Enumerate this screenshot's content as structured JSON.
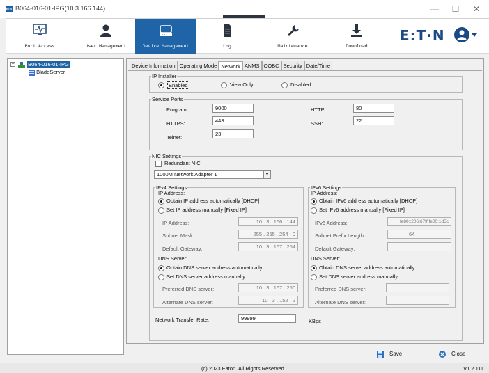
{
  "window": {
    "title": "B064-016-01-IPG(10.3.166.144)",
    "app_icon_text": "ETN",
    "minimize": "—",
    "maximize": "☐",
    "close": "✕"
  },
  "toolbar": {
    "items": [
      {
        "label": "Port Access",
        "icon": "monitor-pulse-icon"
      },
      {
        "label": "User Management",
        "icon": "user-icon"
      },
      {
        "label": "Device Management",
        "icon": "server-icon"
      },
      {
        "label": "Log",
        "icon": "document-icon"
      },
      {
        "label": "Maintenance",
        "icon": "wrench-icon"
      },
      {
        "label": "Download",
        "icon": "download-icon"
      }
    ],
    "active_index": 2,
    "brand": "E:T·N",
    "brand_color": "#1a4a86",
    "accent_color": "#1e64a6"
  },
  "tree": {
    "root": {
      "expander": "−",
      "label": "B064-016-01-IPG"
    },
    "child": {
      "label": "BladeServer"
    }
  },
  "tabs": [
    "Device Information",
    "Operating Mode",
    "Network",
    "ANMS",
    "OOBC",
    "Security",
    "Date/Time"
  ],
  "active_tab": "Network",
  "ip_installer": {
    "legend": "IP Installer",
    "options": [
      "Enabled",
      "View Only",
      "Disabled"
    ],
    "selected": "Enabled"
  },
  "service_ports": {
    "legend": "Service Ports",
    "program": {
      "label": "Program:",
      "value": "9000"
    },
    "https": {
      "label": "HTTPS:",
      "value": "443"
    },
    "telnet": {
      "label": "Telnet:",
      "value": "23"
    },
    "http": {
      "label": "HTTP:",
      "value": "80"
    },
    "ssh": {
      "label": "SSH:",
      "value": "22"
    }
  },
  "nic": {
    "legend": "NIC Settings",
    "redundant_label": "Redundant NIC",
    "redundant_checked": false,
    "adapter": "1000M Network Adapter 1",
    "adapter_arrow": "▾",
    "ipv4": {
      "legend": "IPv4 Settings",
      "ip_address_heading": "IP Address:",
      "auto_label": "Obtain IP address automatically [DHCP]",
      "manual_label": "Set IP address manually [Fixed IP]",
      "selected": "auto",
      "ip_label": "IP Address:",
      "ip_value": "10 . 3 . 166 . 144",
      "mask_label": "Subnet Mask:",
      "mask_value": "255 . 255 . 254 . 0",
      "gateway_label": "Default Gateway:",
      "gateway_value": "10 . 3 . 167 . 254",
      "dns_heading": "DNS Server:",
      "dns_auto_label": "Obtain DNS server address automatically",
      "dns_manual_label": "Set DNS server address manually",
      "dns_selected": "auto",
      "preferred_label": "Preferred DNS server:",
      "preferred_value": "10 . 3 . 167 . 250",
      "alternate_label": "Alternate DNS server:",
      "alternate_value": "10 . 3 . 152 . 2"
    },
    "ipv6": {
      "legend": "IPv6 Settings",
      "ip_address_heading": "IP Address:",
      "auto_label": "Obtain IPv6 address automatically [DHCP]",
      "manual_label": "Set IPv6 address manually [Fixed IP]",
      "selected": "auto",
      "ip_label": "IPv6 Address:",
      "ip_value": "fe80::206:67ff:fe00:1d5c",
      "prefix_label": "Subnet Prefix Length:",
      "prefix_value": "64",
      "gateway_label": "Default Gateway:",
      "gateway_value": "",
      "dns_heading": "DNS Server:",
      "dns_auto_label": "Obtain DNS server address automatically",
      "dns_manual_label": "Set DNS server address manually",
      "dns_selected": "auto",
      "preferred_label": "Preferred DNS server:",
      "preferred_value": "",
      "alternate_label": "Alternate DNS server:",
      "alternate_value": ""
    },
    "transfer_rate": {
      "label": "Network Transfer Rate:",
      "value": "99999",
      "unit": "KBps"
    }
  },
  "buttons": {
    "save": "Save",
    "close": "Close"
  },
  "status": {
    "copyright": "(c) 2023 Eaton. All Rights Reserved.",
    "version": "V1.2.111"
  }
}
